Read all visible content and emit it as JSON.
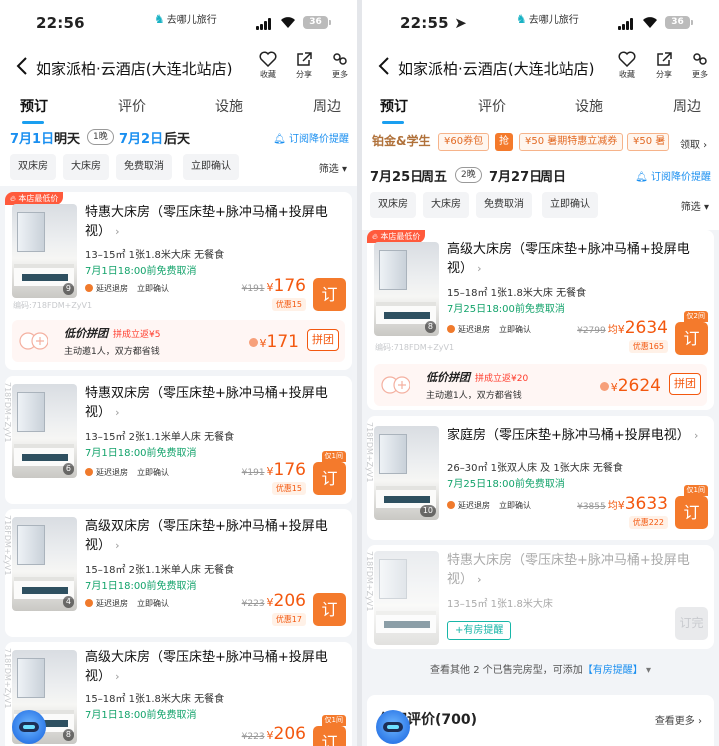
{
  "left": {
    "status": {
      "time": "22:56",
      "brand": "去哪儿旅行",
      "battery": "36"
    },
    "nav": {
      "title": "如家派柏·云酒店(大连北站店)",
      "fav": "收藏",
      "share": "分享",
      "more": "更多"
    },
    "tabs": [
      "预订",
      "评价",
      "设施",
      "周边"
    ],
    "dates": {
      "checkin": "7月1日",
      "checkin_day": "明天",
      "nights": "1晚",
      "checkout": "7月2日",
      "checkout_day": "后天",
      "alert": "订阅降价提醒"
    },
    "filters": [
      "双床房",
      "大床房",
      "免费取消",
      "立即确认"
    ],
    "sift": "筛选",
    "rooms": [
      {
        "tag": "本店最低价",
        "name": "特惠大床房（零压床垫+脉冲马桶+投屏电视）",
        "info": "13–15㎡   1张1.8米大床   无餐食",
        "cancel": "7月1日18:00前免费取消",
        "tags": [
          "延迟退房",
          "立即确认"
        ],
        "old": "¥191",
        "yen": "¥",
        "price": "176",
        "save": "优惠15",
        "book": "订",
        "photos": "9",
        "wm": "编码:718FDM+ZyV1",
        "group": {
          "title": "低价拼团",
          "ret": "拼成立返¥5",
          "sub": "主动邀1人，双方都省钱",
          "price": "171",
          "btn": "拼团"
        }
      },
      {
        "name": "特惠双床房（零压床垫+脉冲马桶+投屏电视）",
        "info": "13–15㎡   2张1.1米单人床   无餐食",
        "cancel": "7月1日18:00前免费取消",
        "tags": [
          "延迟退房",
          "立即确认"
        ],
        "old": "¥191",
        "yen": "¥",
        "price": "176",
        "save": "优惠15",
        "book": "订",
        "only": "仅1间",
        "photos": "6",
        "wm": "718FDM+ZyV1"
      },
      {
        "name": "高级双床房（零压床垫+脉冲马桶+投屏电视）",
        "info": "15–18㎡   2张1.1米单人床   无餐食",
        "cancel": "7月1日18:00前免费取消",
        "tags": [
          "延迟退房",
          "立即确认"
        ],
        "old": "¥223",
        "yen": "¥",
        "price": "206",
        "save": "优惠17",
        "book": "订",
        "photos": "4",
        "wm": "718FDM+ZyV1"
      },
      {
        "name": "高级大床房（零压床垫+脉冲马桶+投屏电视）",
        "info": "15–18㎡   1张1.8米大床   无餐食",
        "cancel": "7月1日18:00前免费取消",
        "old": "¥223",
        "yen": "¥",
        "price": "206",
        "book": "订",
        "only": "仅1间",
        "photos": "8",
        "wm": "718FDM+ZyV1"
      }
    ]
  },
  "right": {
    "status": {
      "time": "22:55",
      "brand": "去哪儿旅行",
      "battery": "36"
    },
    "nav": {
      "title": "如家派柏·云酒店(大连北站店)",
      "fav": "收藏",
      "share": "分享",
      "more": "更多"
    },
    "tabs": [
      "预订",
      "评价",
      "设施",
      "周边"
    ],
    "promo": {
      "vip": "铂金&学生",
      "c1": "¥60券包",
      "grab": "抢",
      "c2": "¥50  暑期特惠立减券",
      "c3": "¥50  暑",
      "get": "领取"
    },
    "dates": {
      "checkin": "7月25日",
      "checkin_day": "周五",
      "nights": "2晚",
      "checkout": "7月27日",
      "checkout_day": "周日",
      "alert": "订阅降价提醒"
    },
    "filters": [
      "双床房",
      "大床房",
      "免费取消",
      "立即确认"
    ],
    "sift": "筛选",
    "rooms": [
      {
        "tag": "本店最低价",
        "name": "高级大床房（零压床垫+脉冲马桶+投屏电视）",
        "info": "15–18㎡   1张1.8米大床   无餐食",
        "cancel": "7月25日18:00前免费取消",
        "tags": [
          "延迟退房",
          "立即确认"
        ],
        "old": "¥2799",
        "per": "均",
        "yen": "¥",
        "price": "2634",
        "save": "优惠165",
        "book": "订",
        "only": "仅2间",
        "photos": "8",
        "wm": "编码:718FDM+ZyV1",
        "group": {
          "title": "低价拼团",
          "ret": "拼成立返¥20",
          "sub": "主动邀1人，双方都省钱",
          "price": "2624",
          "btn": "拼团"
        }
      },
      {
        "name": "家庭房（零压床垫+脉冲马桶+投屏电视）",
        "info": "26–30㎡   1张双人床 及 1张大床   无餐食",
        "cancel": "7月25日18:00前免费取消",
        "tags": [
          "延迟退房",
          "立即确认"
        ],
        "old": "¥3855",
        "per": "均",
        "yen": "¥",
        "price": "3633",
        "save": "优惠222",
        "book": "订",
        "only": "仅1间",
        "photos": "10",
        "wm": "718FDM+ZyV1"
      },
      {
        "name": "特惠大床房（零压床垫+脉冲马桶+投屏电视）",
        "info": "13–15㎡   1张1.8米大床",
        "remind": "+有房提醒",
        "book": "订完",
        "wm": "718FDM+ZyV1"
      }
    ],
    "soldout": {
      "text": "查看其他 2 个已售完房型，可添加",
      "link": "【有房提醒】"
    },
    "review": {
      "title": "住客评价(700)",
      "more": "查看更多"
    }
  }
}
